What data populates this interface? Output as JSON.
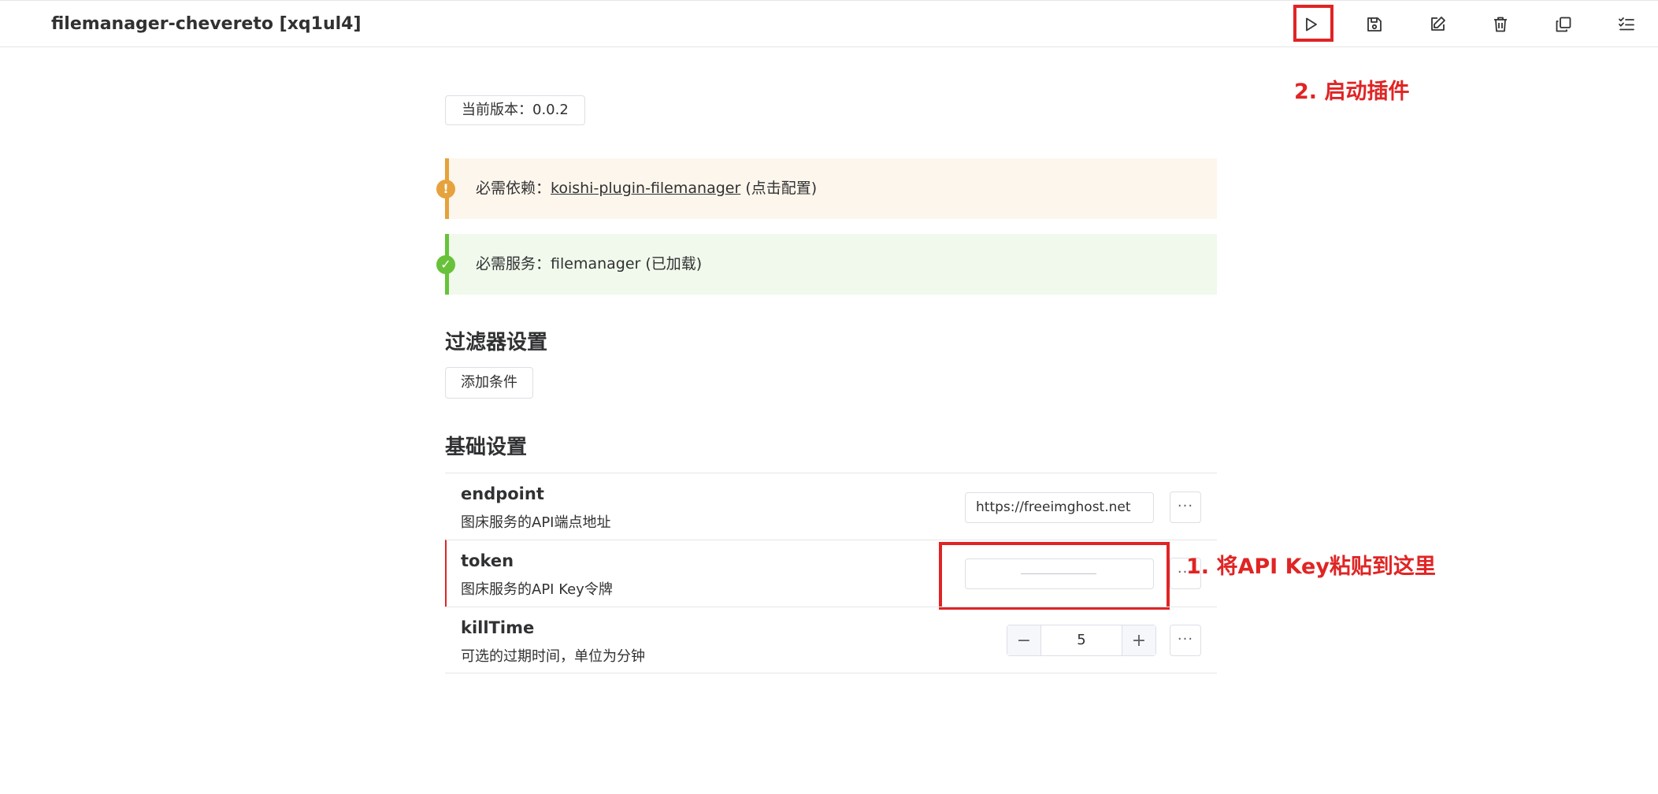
{
  "header": {
    "title": "filemanager-chevereto [xq1ul4]"
  },
  "toolbar": {
    "icons": [
      "play-icon",
      "save-icon",
      "edit-icon",
      "trash-icon",
      "copy-icon",
      "list-check-icon"
    ]
  },
  "annotations": {
    "start_plugin": "2. 启动插件",
    "paste_key": "1. 将API Key粘贴到这里",
    "color": "#e02424"
  },
  "version": {
    "label": "当前版本：0.0.2"
  },
  "alerts": {
    "dependency": {
      "prefix": "必需依赖：",
      "link": "koishi-plugin-filemanager",
      "suffix": " (点击配置)",
      "color": "#e6a23c"
    },
    "service": {
      "prefix": "必需服务：",
      "name": "filemanager",
      "suffix": " (已加载)",
      "color": "#67c23a"
    }
  },
  "filter": {
    "title": "过滤器设置",
    "add_button": "添加条件"
  },
  "basic": {
    "title": "基础设置",
    "endpoint": {
      "name": "endpoint",
      "desc": "图床服务的API端点地址",
      "value": "https://freeimghost.net"
    },
    "token": {
      "name": "token",
      "desc": "图床服务的API Key令牌",
      "value": ""
    },
    "killTime": {
      "name": "killTime",
      "desc": "可选的过期时间，单位为分钟",
      "value": "5",
      "minus": "−",
      "plus": "+"
    },
    "more_label": "···"
  }
}
